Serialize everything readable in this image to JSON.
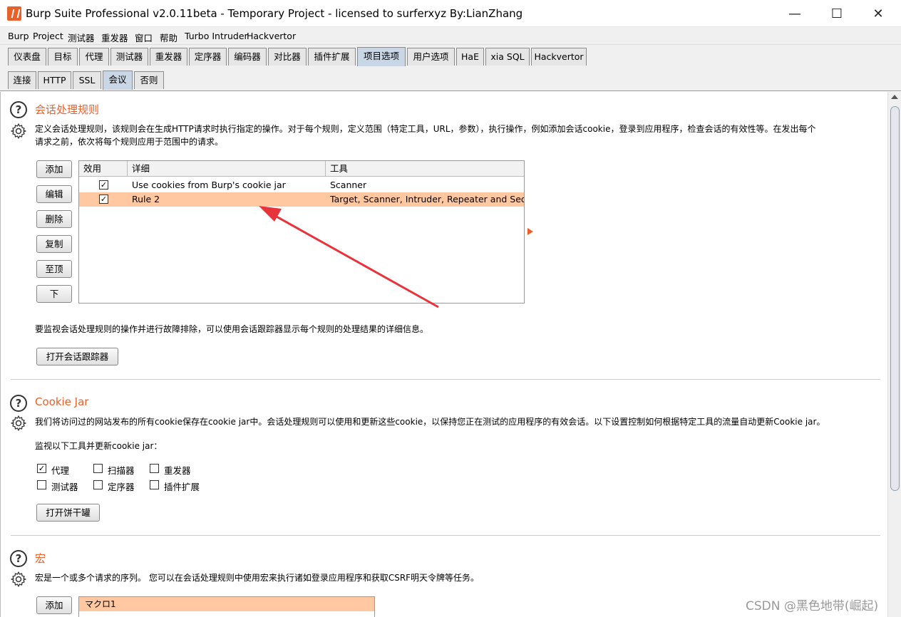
{
  "window": {
    "title": "Burp Suite Professional v2.0.11beta - Temporary Project - licensed to surferxyz By:LianZhang",
    "minimize": "—",
    "maximize": "☐",
    "close": "✕"
  },
  "menu": [
    "Burp",
    "Project",
    "测试器",
    "重发器",
    "窗口",
    "帮助",
    "Turbo Intruder",
    "Hackvertor"
  ],
  "main_tabs": [
    "仪表盘",
    "目标",
    "代理",
    "测试器",
    "重发器",
    "定序器",
    "编码器",
    "对比器",
    "插件扩展",
    "项目选项",
    "用户选项",
    "HaE",
    "xia SQL",
    "Hackvertor"
  ],
  "main_tab_active": "项目选项",
  "sub_tabs": [
    "连接",
    "HTTP",
    "SSL",
    "会议",
    "否则"
  ],
  "sub_tab_active": "会议",
  "session_rules": {
    "title": "会话处理规则",
    "desc_line1": "定义会话处理规则，该规则会在生成HTTP请求时执行指定的操作。对于每个规则，定义范围（特定工具，URL，参数），执行操作，例如添加会话cookie，登录到应用程序，检查会话的有效性等。在发出每个",
    "desc_line2": "请求之前，依次将每个规则应用于范围中的请求。",
    "buttons": [
      "添加",
      "编辑",
      "删除",
      "复制",
      "至顶",
      "下"
    ],
    "columns": [
      "效用",
      "详细",
      "工具"
    ],
    "rows": [
      {
        "enabled": true,
        "detail": "Use cookies from Burp's cookie jar",
        "tools": "Scanner"
      },
      {
        "enabled": true,
        "detail": "Rule 2",
        "tools": "Target, Scanner, Intruder, Repeater and Seq..."
      }
    ],
    "selected_row": 1,
    "tracer_desc": "要监视会话处理规则的操作并进行故障排除，可以使用会话跟踪器显示每个规则的处理结果的详细信息。",
    "tracer_button": "打开会话跟踪器"
  },
  "cookie_jar": {
    "title": "Cookie Jar",
    "desc": "我们将访问过的网站发布的所有cookie保存在cookie jar中。会话处理规则可以使用和更新这些cookie，以保持您正在测试的应用程序的有效会话。以下设置控制如何根据特定工具的流量自动更新Cookie jar。",
    "monitor_label": "监视以下工具并更新cookie jar：",
    "tools": [
      {
        "label": "代理",
        "checked": true
      },
      {
        "label": "扫描器",
        "checked": false
      },
      {
        "label": "重发器",
        "checked": false
      },
      {
        "label": "测试器",
        "checked": false
      },
      {
        "label": "定序器",
        "checked": false
      },
      {
        "label": "插件扩展",
        "checked": false
      }
    ],
    "open_button": "打开饼干罐"
  },
  "macros": {
    "title": "宏",
    "desc": "宏是一个或多个请求的序列。 您可以在会话处理规则中使用宏来执行诸如登录应用程序和获取CSRF明天令牌等任务。",
    "add_button": "添加",
    "items": [
      "マクロ1"
    ]
  },
  "watermark": "CSDN @黑色地带(崛起)",
  "colors": {
    "accent": "#e8602a",
    "selection": "#ffc8a0",
    "arrow": "#e8333a"
  }
}
